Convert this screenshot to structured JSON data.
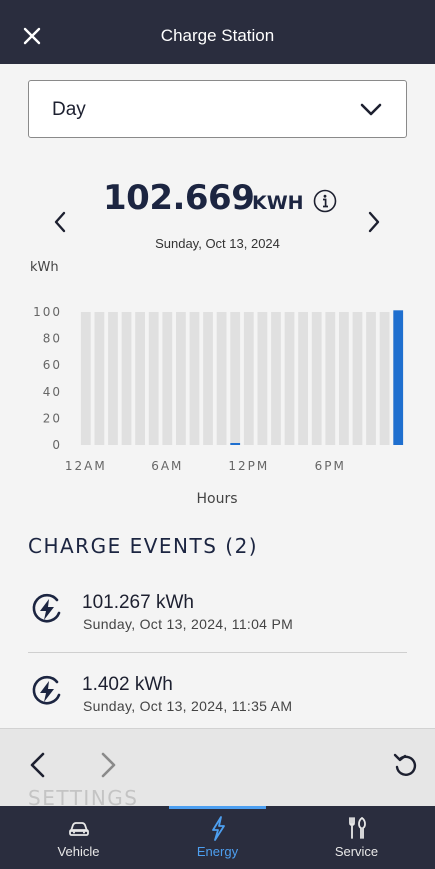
{
  "header": {
    "title": "Charge Station",
    "close_icon": "close-icon"
  },
  "period_select": {
    "value": "Day",
    "icon": "chevron-down-icon"
  },
  "summary": {
    "value": "102.669",
    "unit": "KWH",
    "date": "Sunday, Oct 13, 2024"
  },
  "chart_data": {
    "type": "bar",
    "ylabel": "kWh",
    "xlabel": "Hours",
    "ylim": [
      0,
      100
    ],
    "yticks": [
      "100",
      "80",
      "60",
      "40",
      "20",
      "0"
    ],
    "xtick_labels": [
      "12AM",
      "6AM",
      "12PM",
      "6PM"
    ],
    "categories": [
      "12AM",
      "1AM",
      "2AM",
      "3AM",
      "4AM",
      "5AM",
      "6AM",
      "7AM",
      "8AM",
      "9AM",
      "10AM",
      "11AM",
      "12PM",
      "1PM",
      "2PM",
      "3PM",
      "4PM",
      "5PM",
      "6PM",
      "7PM",
      "8PM",
      "9PM",
      "10PM",
      "11PM"
    ],
    "values": [
      0,
      0,
      0,
      0,
      0,
      0,
      0,
      0,
      0,
      0,
      0,
      1.402,
      0,
      0,
      0,
      0,
      0,
      0,
      0,
      0,
      0,
      0,
      0,
      101.267
    ],
    "bar_color": "#1f6fcf",
    "background_bar_color": "#e0e0e0",
    "grid": false
  },
  "events": {
    "title": "CHARGE EVENTS (2)",
    "items": [
      {
        "kwh": "101.267 kWh",
        "when": "Sunday, Oct 13, 2024, 11:04 PM"
      },
      {
        "kwh": "1.402 kWh",
        "when": "Sunday, Oct 13, 2024, 11:35 AM"
      }
    ]
  },
  "browser_nav": {
    "back_icon": "chevron-left-icon",
    "forward_icon": "chevron-right-icon",
    "reload_icon": "reload-icon"
  },
  "settings_heading": "SETTINGS",
  "tabs": [
    {
      "label": "Vehicle",
      "icon": "car-icon",
      "active": false
    },
    {
      "label": "Energy",
      "icon": "lightning-icon",
      "active": true
    },
    {
      "label": "Service",
      "icon": "tools-icon",
      "active": false
    }
  ],
  "colors": {
    "header_bg": "#2a2d3e",
    "accent": "#4d9ff0",
    "heading_text": "#1c2541"
  }
}
